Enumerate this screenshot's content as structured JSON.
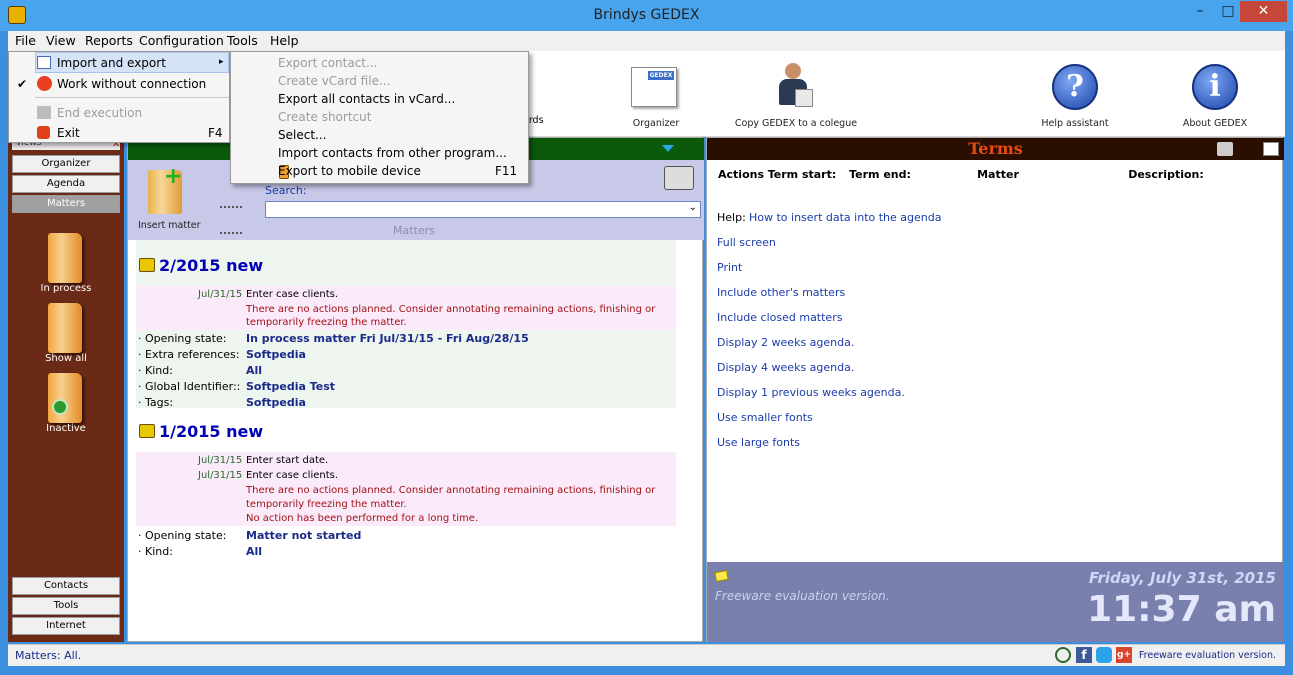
{
  "window": {
    "title": "Brindys GEDEX",
    "minimize": "–",
    "maximize": "□",
    "close": "✕"
  },
  "menubar": {
    "items": [
      "File",
      "View",
      "Reports",
      "Configuration",
      "Tools",
      "Help"
    ]
  },
  "file_menu": {
    "import_export": "Import and export",
    "work_offline": "Work without connection",
    "end_execution": "End execution",
    "exit": "Exit",
    "exit_shortcut": "F4"
  },
  "submenu": {
    "items": [
      {
        "label": "Export contact...",
        "disabled": true
      },
      {
        "label": "Create vCard file...",
        "disabled": true
      },
      {
        "label": "Export all contacts in vCard...",
        "disabled": false
      },
      {
        "label": "Create shortcut",
        "disabled": true
      },
      {
        "label": "Select...",
        "disabled": false
      },
      {
        "label": "Import contacts from other program...",
        "disabled": false
      },
      {
        "label": "Export to mobile device",
        "disabled": false,
        "shortcut": "F11"
      }
    ]
  },
  "toolbar": {
    "partial_label": "ards",
    "organizer": "Organizer",
    "copy_gedex": "Copy GEDEX to a colegue",
    "help_assistant": "Help assistant",
    "about": "About GEDEX",
    "help_glyph": "?",
    "about_glyph": "i",
    "organizer_logo": "GEDEX"
  },
  "views": {
    "header": "views",
    "tabs": [
      "Organizer",
      "Agenda",
      "Matters"
    ],
    "selected": "Matters",
    "folders": [
      "In process",
      "Show all",
      "Inactive"
    ],
    "bottom_tabs": [
      "Contacts",
      "Tools",
      "Internet"
    ]
  },
  "matters": {
    "insert_label": "Insert matter",
    "search_label": "Search:",
    "panel_label": "Matters",
    "entries": [
      {
        "title": "2/2015 new",
        "notes": [
          {
            "date": "Jul/31/15",
            "text": "Enter case clients."
          },
          {
            "date": "",
            "text": "There are no actions planned. Consider annotating remaining actions, finishing or",
            "warn": true
          },
          {
            "date": "",
            "text": "temporarily freezing the matter.",
            "warn": true
          }
        ],
        "fields": [
          {
            "label": "· Opening state:",
            "value": "In process matter Fri Jul/31/15 - Fri Aug/28/15"
          },
          {
            "label": "· Extra references:",
            "value": "Softpedia"
          },
          {
            "label": "· Kind:",
            "value": "All"
          },
          {
            "label": "· Global Identifier::",
            "value": "Softpedia Test"
          },
          {
            "label": "· Tags:",
            "value": "Softpedia"
          }
        ]
      },
      {
        "title": "1/2015 new",
        "notes": [
          {
            "date": "Jul/31/15",
            "text": "Enter start date."
          },
          {
            "date": "Jul/31/15",
            "text": "Enter case clients."
          },
          {
            "date": "",
            "text": "There are no actions planned. Consider annotating remaining actions, finishing or",
            "warn": true
          },
          {
            "date": "",
            "text": "temporarily freezing the matter.",
            "warn": true
          },
          {
            "date": "",
            "text": "No action has been performed for a long time.",
            "warn": true
          }
        ],
        "fields": [
          {
            "label": "· Opening state:",
            "value": "Matter not started"
          },
          {
            "label": "· Kind:",
            "value": "All"
          }
        ]
      }
    ]
  },
  "terms": {
    "title": "Terms",
    "columns": [
      "Actions",
      "Term start:",
      "Term end:",
      "Matter",
      "Description:"
    ],
    "help_prefix": "Help:",
    "links": [
      "How to insert data into the agenda",
      "Full screen",
      "Print",
      "Include other's matters",
      "Include closed matters",
      "Display 2 weeks agenda.",
      "Display 4 weeks agenda.",
      "Display 1 previous weeks agenda.",
      "Use smaller fonts",
      "Use large fonts"
    ],
    "freeware": "Freeware evaluation version.",
    "date": "Friday, July 31st, 2015",
    "time": "11:37 am"
  },
  "status": {
    "left": "Matters: All.",
    "right": "Freeware evaluation version."
  },
  "colors": {
    "accent": "#0000b4",
    "link": "#1a3ca8",
    "warn": "#a01414",
    "date_green": "#2a6a2a"
  }
}
